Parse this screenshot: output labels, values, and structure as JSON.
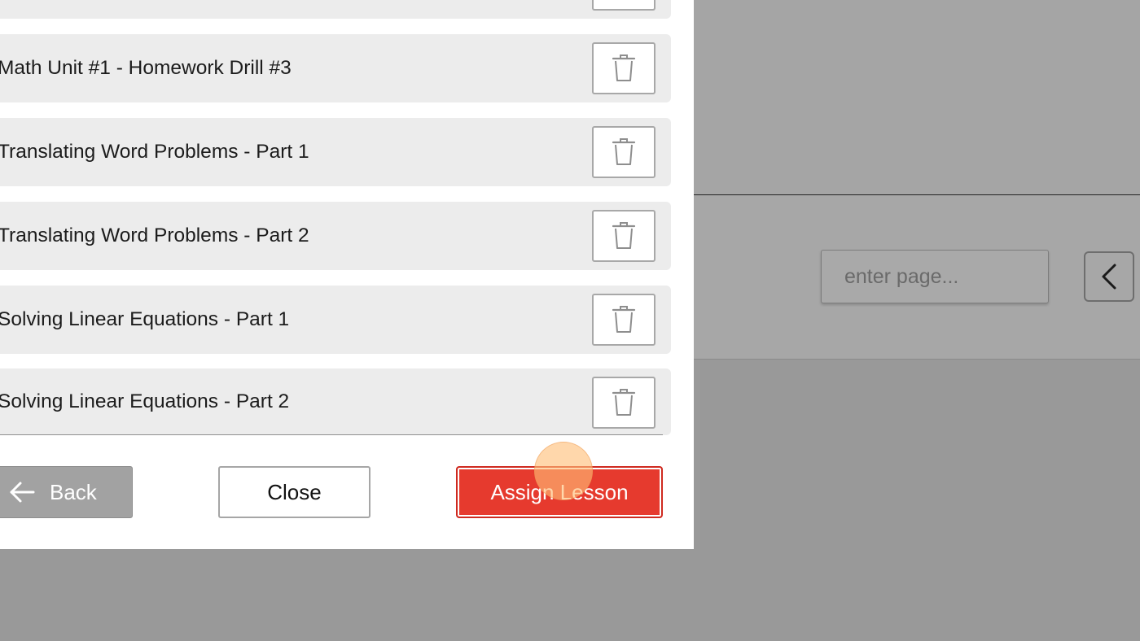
{
  "lesson_list": {
    "items": [
      {
        "label": ""
      },
      {
        "label": "Math Unit #1 - Homework Drill #3"
      },
      {
        "label": "Translating Word Problems - Part 1"
      },
      {
        "label": "Translating Word Problems - Part 2"
      },
      {
        "label": "Solving Linear Equations - Part 1"
      },
      {
        "label": "Solving Linear Equations - Part 2"
      }
    ],
    "delete_icon": "trash-icon"
  },
  "footer": {
    "back_label": "Back",
    "close_label": "Close",
    "assign_label": "Assign Lesson"
  },
  "pagination": {
    "page_placeholder": "enter page...",
    "prev_icon": "chevron-left-icon"
  },
  "colors": {
    "assign_button": "#e63a2e",
    "row_background": "#ececec",
    "back_button": "#a2a2a2",
    "overlay": "#999999"
  }
}
